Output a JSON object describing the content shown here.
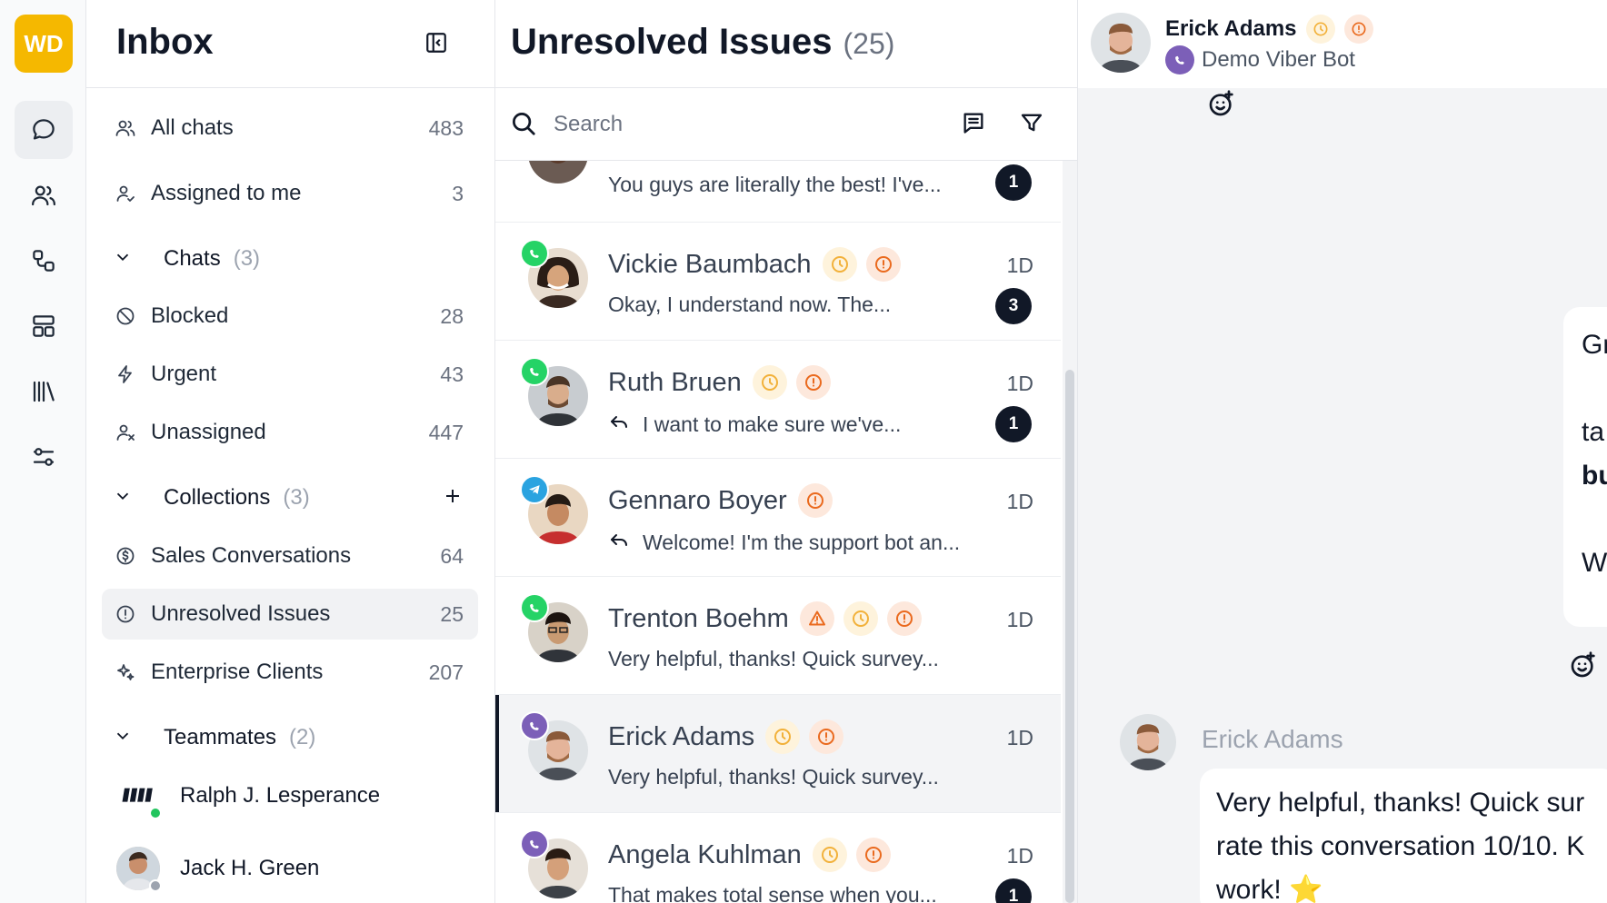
{
  "workspace": {
    "initials": "WD",
    "color": "#f5b800"
  },
  "rail": {
    "items": [
      {
        "name": "chats",
        "icon": "chat-bubble-icon",
        "active": true
      },
      {
        "name": "contacts",
        "icon": "users-icon"
      },
      {
        "name": "workflows",
        "icon": "workflow-icon"
      },
      {
        "name": "layout",
        "icon": "layout-icon"
      },
      {
        "name": "library",
        "icon": "library-icon"
      },
      {
        "name": "settings",
        "icon": "sliders-icon"
      }
    ]
  },
  "sidebar": {
    "title": "Inbox",
    "items": [
      {
        "label": "All chats",
        "count": "483",
        "icon": "users-icon"
      },
      {
        "label": "Assigned to me",
        "count": "3",
        "icon": "user-check-icon"
      },
      {
        "label": "Blocked",
        "count": "28",
        "icon": "blocked-icon"
      },
      {
        "label": "Urgent",
        "count": "43",
        "icon": "lightning-icon"
      },
      {
        "label": "Unassigned",
        "count": "447",
        "icon": "user-x-icon"
      },
      {
        "label": "Sales Conversations",
        "count": "64",
        "icon": "dollar-icon"
      },
      {
        "label": "Unresolved Issues",
        "count": "25",
        "icon": "alert-circle-icon",
        "active": true
      },
      {
        "label": "Enterprise Clients",
        "count": "207",
        "icon": "sparkles-icon"
      }
    ],
    "sections": {
      "chats": {
        "label": "Chats",
        "count": "(3)"
      },
      "collections": {
        "label": "Collections",
        "count": "(3)"
      },
      "teammates": {
        "label": "Teammates",
        "count": "(2)"
      }
    },
    "teammates": [
      {
        "name": "Ralph J. Lesperance",
        "status_color": "#22c55e"
      },
      {
        "name": "Jack H. Green",
        "status_color": "#9ca3af"
      }
    ]
  },
  "list": {
    "title": "Unresolved Issues",
    "count": "(25)",
    "search_placeholder": "Search",
    "conversations": [
      {
        "name": "",
        "message": "You guys are literally the best! I've...",
        "time": "",
        "unread": "1",
        "channel": "",
        "tags": []
      },
      {
        "name": "Vickie Baumbach",
        "message": "Okay, I understand now. The...",
        "time": "1D",
        "unread": "3",
        "channel": "whatsapp",
        "tags": [
          "clock",
          "excl"
        ]
      },
      {
        "name": "Ruth Bruen",
        "message": "I want to make sure we've...",
        "time": "1D",
        "unread": "1",
        "channel": "whatsapp",
        "reply": true,
        "tags": [
          "clock",
          "excl"
        ]
      },
      {
        "name": "Gennaro Boyer",
        "message": "Welcome! I'm the support bot an...",
        "time": "1D",
        "unread": "",
        "channel": "telegram",
        "reply": true,
        "tags": [
          "excl"
        ]
      },
      {
        "name": "Trenton Boehm",
        "message": "Very helpful, thanks! Quick survey...",
        "time": "1D",
        "unread": "",
        "channel": "whatsapp",
        "tags": [
          "warn",
          "clock",
          "excl"
        ]
      },
      {
        "name": "Erick Adams",
        "message": "Very helpful, thanks! Quick survey...",
        "time": "1D",
        "unread": "",
        "channel": "viber",
        "selected": true,
        "tags": [
          "clock",
          "excl"
        ]
      },
      {
        "name": "Angela Kuhlman",
        "message": "That makes total sense when you...",
        "time": "1D",
        "unread": "1",
        "channel": "viber",
        "tags": [
          "clock",
          "excl"
        ]
      }
    ]
  },
  "chat": {
    "contact_name": "Erick Adams",
    "channel_name": "Demo Viber Bot",
    "partial_bubble_lines": [
      "Gr",
      "",
      "ta",
      "bu",
      "",
      "W"
    ],
    "peer_name": "Erick Adams",
    "message_lines": [
      "Very helpful, thanks! Quick sur",
      "rate this conversation 10/10. K",
      "work!"
    ],
    "message_emoji": "⭐"
  },
  "colors": {
    "whatsapp": "#25d366",
    "telegram": "#2aa3e0",
    "viber": "#7c5fb8",
    "clock_tag": "#f2b13a",
    "alert_tag": "#ea6a1e"
  }
}
